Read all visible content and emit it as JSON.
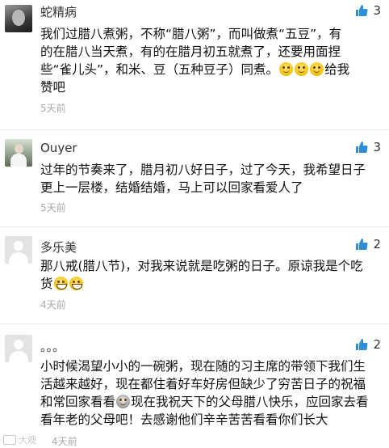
{
  "comments": [
    {
      "username": "蛇精病",
      "likes": "3",
      "text": "我们过腊八煮粥，不称“腊八粥”，而叫做煮“五豆”，有\n的在腊八当天煮，有的在腊月初五就煮了，还要用面捏\n些“雀儿头”，和米、豆（五种豆子）同煮。",
      "text_tail": "给我\n赞吧",
      "time": "5天前"
    },
    {
      "username": "Ouyer",
      "likes": "3",
      "text": "过年的节奏来了，腊月初八好日子，过了今天，我希望日子\n更上一层楼，结婚结婚，马上可以回家看爱人了",
      "time": "5天前"
    },
    {
      "username": "多乐美",
      "likes": "2",
      "text": "那八戒(腊八节)，对我来说就是吃粥的日子。原谅我是个吃\n货",
      "time": "4天前"
    },
    {
      "username": "。。。",
      "likes": "2",
      "text_part1": "小时候渴望小小的一碗粥，现在随的习主席的带领下我们生\n活越来越好，现在都住着好车好房但缺少了穷苦日子的祝福\n和常回家看看",
      "text_part2": "现在我祝天下的父母腊八快乐，应回家去看\n看年老的父母吧！去感谢他们辛辛苦苦看看你们长大",
      "time": "4天前"
    }
  ],
  "watermark": "大观"
}
